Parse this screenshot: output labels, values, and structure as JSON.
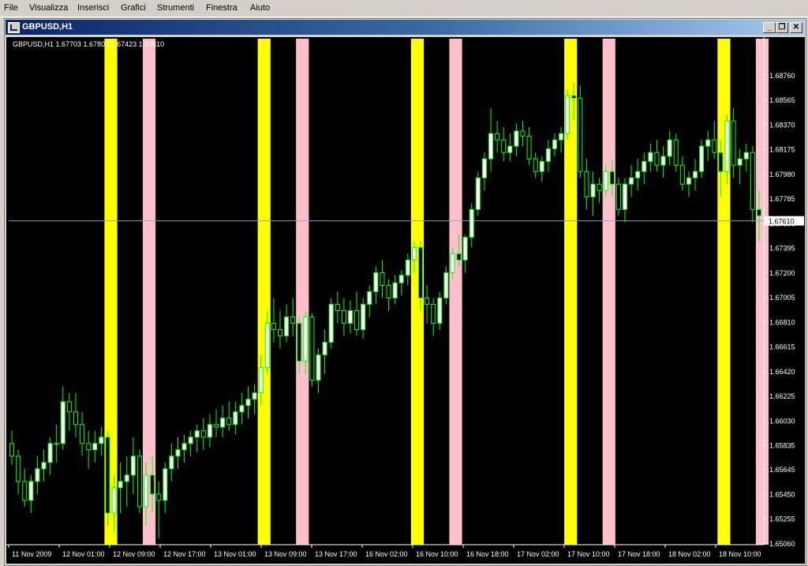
{
  "menu": [
    "File",
    "Visualizza",
    "Inserisci",
    "Grafici",
    "Strumenti",
    "Finestra",
    "Aiuto"
  ],
  "window": {
    "title": "GBPUSD,H1",
    "buttons": {
      "minimize": "_",
      "restore": "❐",
      "close": "✕"
    }
  },
  "colors": {
    "background": "#000000",
    "bull_body": "#ffffff",
    "bear_body": "#000000",
    "wick": "#00ff00",
    "session_a": "#ffff00",
    "session_b": "#ffc0cb",
    "axis_text": "#ffffff",
    "price_line": "#8fa3b8"
  },
  "chart_data": {
    "type": "candlestick",
    "info_label": "GBPUSD,H1  1.67703 1.67802 1.67423 1.67610",
    "current_price_label": "1.67610",
    "current_price": 1.6761,
    "ylim": [
      1.6505,
      1.6905
    ],
    "yticks": [
      "1.68760",
      "1.68565",
      "1.68370",
      "1.68175",
      "1.67980",
      "1.67785",
      "1.67590",
      "1.67395",
      "1.67200",
      "1.67005",
      "1.66810",
      "1.66615",
      "1.66420",
      "1.66225",
      "1.66030",
      "1.65835",
      "1.65645",
      "1.65450",
      "1.65255",
      "1.65060"
    ],
    "xticks": [
      "11 Nov 2009",
      "12 Nov 01:00",
      "12 Nov 09:00",
      "12 Nov 17:00",
      "13 Nov 01:00",
      "13 Nov 09:00",
      "13 Nov 17:00",
      "16 Nov 02:00",
      "16 Nov 10:00",
      "16 Nov 18:00",
      "17 Nov 02:00",
      "17 Nov 10:00",
      "17 Nov 18:00",
      "18 Nov 02:00",
      "18 Nov 10:00"
    ],
    "session_bands": [
      {
        "color": "session_a",
        "start_bar": 15,
        "end_bar": 17
      },
      {
        "color": "session_b",
        "start_bar": 21,
        "end_bar": 23
      },
      {
        "color": "session_a",
        "start_bar": 39,
        "end_bar": 41
      },
      {
        "color": "session_b",
        "start_bar": 45,
        "end_bar": 47
      },
      {
        "color": "session_a",
        "start_bar": 63,
        "end_bar": 65
      },
      {
        "color": "session_b",
        "start_bar": 69,
        "end_bar": 71
      },
      {
        "color": "session_a",
        "start_bar": 87,
        "end_bar": 89
      },
      {
        "color": "session_b",
        "start_bar": 93,
        "end_bar": 95
      },
      {
        "color": "session_a",
        "start_bar": 111,
        "end_bar": 113
      },
      {
        "color": "session_b",
        "start_bar": 117,
        "end_bar": 119
      }
    ],
    "ohlc": [
      [
        1.6585,
        1.6595,
        1.6568,
        1.6575
      ],
      [
        1.6575,
        1.658,
        1.6545,
        1.6555
      ],
      [
        1.6555,
        1.6565,
        1.6535,
        1.654
      ],
      [
        1.654,
        1.656,
        1.653,
        1.6555
      ],
      [
        1.6555,
        1.6575,
        1.6545,
        1.6565
      ],
      [
        1.6565,
        1.658,
        1.6555,
        1.657
      ],
      [
        1.657,
        1.659,
        1.656,
        1.6585
      ],
      [
        1.6585,
        1.66,
        1.657,
        1.6585
      ],
      [
        1.6585,
        1.663,
        1.658,
        1.6618
      ],
      [
        1.6618,
        1.6625,
        1.6595,
        1.661
      ],
      [
        1.661,
        1.6625,
        1.659,
        1.66
      ],
      [
        1.66,
        1.661,
        1.6575,
        1.6585
      ],
      [
        1.6585,
        1.6595,
        1.6565,
        1.658
      ],
      [
        1.658,
        1.6595,
        1.657,
        1.6585
      ],
      [
        1.6585,
        1.6598,
        1.6575,
        1.659
      ],
      [
        1.659,
        1.6595,
        1.652,
        1.653
      ],
      [
        1.653,
        1.656,
        1.6515,
        1.655
      ],
      [
        1.655,
        1.657,
        1.653,
        1.6555
      ],
      [
        1.6555,
        1.6575,
        1.6535,
        1.656
      ],
      [
        1.656,
        1.659,
        1.6545,
        1.6575
      ],
      [
        1.6575,
        1.658,
        1.653,
        1.6535
      ],
      [
        1.6535,
        1.657,
        1.652,
        1.656
      ],
      [
        1.656,
        1.6575,
        1.653,
        1.6545
      ],
      [
        1.6545,
        1.6555,
        1.651,
        1.654
      ],
      [
        1.654,
        1.657,
        1.653,
        1.6565
      ],
      [
        1.6565,
        1.6585,
        1.6555,
        1.6575
      ],
      [
        1.6575,
        1.659,
        1.6565,
        1.658
      ],
      [
        1.658,
        1.6592,
        1.657,
        1.6585
      ],
      [
        1.6585,
        1.6595,
        1.6575,
        1.659
      ],
      [
        1.659,
        1.66,
        1.6578,
        1.6595
      ],
      [
        1.6595,
        1.6605,
        1.658,
        1.659
      ],
      [
        1.659,
        1.6608,
        1.6582,
        1.66
      ],
      [
        1.66,
        1.6612,
        1.659,
        1.6598
      ],
      [
        1.6598,
        1.6615,
        1.659,
        1.6605
      ],
      [
        1.6605,
        1.6618,
        1.6595,
        1.66
      ],
      [
        1.66,
        1.6618,
        1.6592,
        1.661
      ],
      [
        1.661,
        1.6625,
        1.66,
        1.6615
      ],
      [
        1.6615,
        1.663,
        1.6605,
        1.662
      ],
      [
        1.662,
        1.6632,
        1.6608,
        1.6625
      ],
      [
        1.6625,
        1.6655,
        1.6615,
        1.6645
      ],
      [
        1.6645,
        1.669,
        1.664,
        1.668
      ],
      [
        1.668,
        1.67,
        1.6665,
        1.6675
      ],
      [
        1.6675,
        1.669,
        1.666,
        1.667
      ],
      [
        1.667,
        1.6695,
        1.6665,
        1.6685
      ],
      [
        1.6685,
        1.67,
        1.667,
        1.668
      ],
      [
        1.668,
        1.6685,
        1.664,
        1.665
      ],
      [
        1.665,
        1.669,
        1.664,
        1.6685
      ],
      [
        1.6685,
        1.6688,
        1.663,
        1.6635
      ],
      [
        1.6635,
        1.666,
        1.6625,
        1.6655
      ],
      [
        1.6655,
        1.6675,
        1.664,
        1.6665
      ],
      [
        1.6665,
        1.67,
        1.666,
        1.6695
      ],
      [
        1.6695,
        1.6705,
        1.668,
        1.669
      ],
      [
        1.669,
        1.67,
        1.667,
        1.668
      ],
      [
        1.668,
        1.6698,
        1.6672,
        1.669
      ],
      [
        1.669,
        1.6705,
        1.667,
        1.6675
      ],
      [
        1.6675,
        1.67,
        1.6668,
        1.6695
      ],
      [
        1.6695,
        1.671,
        1.6685,
        1.6705
      ],
      [
        1.6705,
        1.6725,
        1.6695,
        1.672
      ],
      [
        1.672,
        1.673,
        1.67,
        1.671
      ],
      [
        1.671,
        1.6715,
        1.669,
        1.67
      ],
      [
        1.67,
        1.6718,
        1.6695,
        1.6712
      ],
      [
        1.6712,
        1.6722,
        1.6702,
        1.6718
      ],
      [
        1.6718,
        1.6735,
        1.671,
        1.673
      ],
      [
        1.673,
        1.6745,
        1.672,
        1.674
      ],
      [
        1.674,
        1.6745,
        1.669,
        1.67
      ],
      [
        1.67,
        1.671,
        1.668,
        1.6695
      ],
      [
        1.6695,
        1.67,
        1.667,
        1.668
      ],
      [
        1.668,
        1.6705,
        1.6675,
        1.67
      ],
      [
        1.67,
        1.6725,
        1.6695,
        1.672
      ],
      [
        1.672,
        1.674,
        1.6715,
        1.6735
      ],
      [
        1.6735,
        1.675,
        1.6725,
        1.673
      ],
      [
        1.673,
        1.675,
        1.672,
        1.6748
      ],
      [
        1.6748,
        1.6775,
        1.674,
        1.677
      ],
      [
        1.677,
        1.68,
        1.6765,
        1.6795
      ],
      [
        1.6795,
        1.6815,
        1.6785,
        1.681
      ],
      [
        1.681,
        1.685,
        1.68,
        1.683
      ],
      [
        1.683,
        1.684,
        1.6815,
        1.6825
      ],
      [
        1.6825,
        1.6835,
        1.6808,
        1.6815
      ],
      [
        1.6815,
        1.683,
        1.6808,
        1.682
      ],
      [
        1.682,
        1.6838,
        1.6812,
        1.6832
      ],
      [
        1.6832,
        1.684,
        1.682,
        1.6828
      ],
      [
        1.6828,
        1.6835,
        1.6805,
        1.681
      ],
      [
        1.681,
        1.6815,
        1.6795,
        1.68
      ],
      [
        1.68,
        1.6812,
        1.6792,
        1.6808
      ],
      [
        1.6808,
        1.6825,
        1.68,
        1.6818
      ],
      [
        1.6818,
        1.683,
        1.6812,
        1.6825
      ],
      [
        1.6825,
        1.6835,
        1.6815,
        1.683
      ],
      [
        1.683,
        1.6865,
        1.6825,
        1.686
      ],
      [
        1.686,
        1.687,
        1.684,
        1.6858
      ],
      [
        1.6858,
        1.6868,
        1.6795,
        1.68
      ],
      [
        1.68,
        1.681,
        1.677,
        1.678
      ],
      [
        1.678,
        1.68,
        1.6765,
        1.679
      ],
      [
        1.679,
        1.6795,
        1.6775,
        1.6785
      ],
      [
        1.6785,
        1.6805,
        1.678,
        1.68
      ],
      [
        1.68,
        1.681,
        1.678,
        1.679
      ],
      [
        1.679,
        1.6795,
        1.6765,
        1.677
      ],
      [
        1.677,
        1.6795,
        1.676,
        1.679
      ],
      [
        1.679,
        1.6805,
        1.678,
        1.6795
      ],
      [
        1.6795,
        1.681,
        1.6785,
        1.68
      ],
      [
        1.68,
        1.6815,
        1.679,
        1.6808
      ],
      [
        1.6808,
        1.6822,
        1.68,
        1.6815
      ],
      [
        1.6815,
        1.6825,
        1.68,
        1.6805
      ],
      [
        1.6805,
        1.682,
        1.6795,
        1.6812
      ],
      [
        1.6812,
        1.6832,
        1.6805,
        1.6825
      ],
      [
        1.6825,
        1.683,
        1.68,
        1.6805
      ],
      [
        1.6805,
        1.6812,
        1.6785,
        1.679
      ],
      [
        1.679,
        1.68,
        1.678,
        1.6795
      ],
      [
        1.6795,
        1.681,
        1.6785,
        1.68
      ],
      [
        1.68,
        1.6825,
        1.6795,
        1.682
      ],
      [
        1.682,
        1.6832,
        1.6808,
        1.6825
      ],
      [
        1.6825,
        1.684,
        1.681,
        1.6815
      ],
      [
        1.6815,
        1.6825,
        1.678,
        1.68
      ],
      [
        1.68,
        1.6845,
        1.679,
        1.684
      ],
      [
        1.684,
        1.685,
        1.6795,
        1.6805
      ],
      [
        1.6805,
        1.6818,
        1.679,
        1.681
      ],
      [
        1.681,
        1.6822,
        1.68,
        1.6815
      ],
      [
        1.6815,
        1.682,
        1.676,
        1.677
      ],
      [
        1.677,
        1.6785,
        1.6745,
        1.6765
      ]
    ]
  }
}
